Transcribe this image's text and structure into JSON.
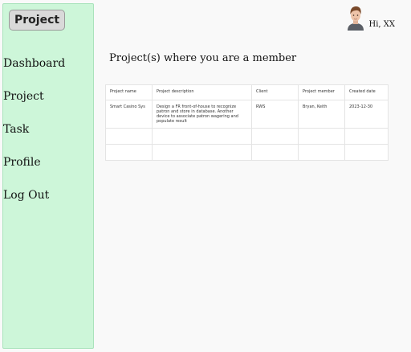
{
  "sidebar": {
    "logo_label": "Project",
    "items": [
      {
        "label": "Dashboard"
      },
      {
        "label": "Project"
      },
      {
        "label": "Task"
      },
      {
        "label": "Profile"
      },
      {
        "label": "Log Out"
      }
    ]
  },
  "header": {
    "greeting": "Hi, XX"
  },
  "main": {
    "heading": "Project(s) where you are a member",
    "table": {
      "columns": [
        "Project name",
        "Project description",
        "Client",
        "Project member",
        "Created date"
      ],
      "rows": [
        {
          "project_name": "Smart Casino Sys",
          "description": "Design a FR front-of-house to recognize patron and store in database. Another device to associate patron wagering and populate result",
          "client": "RWS",
          "member": "Bryan, Keith",
          "created": "2023-12-30"
        },
        {
          "project_name": "",
          "description": "",
          "client": "",
          "member": "",
          "created": ""
        },
        {
          "project_name": "",
          "description": "",
          "client": "",
          "member": "",
          "created": ""
        }
      ]
    }
  }
}
